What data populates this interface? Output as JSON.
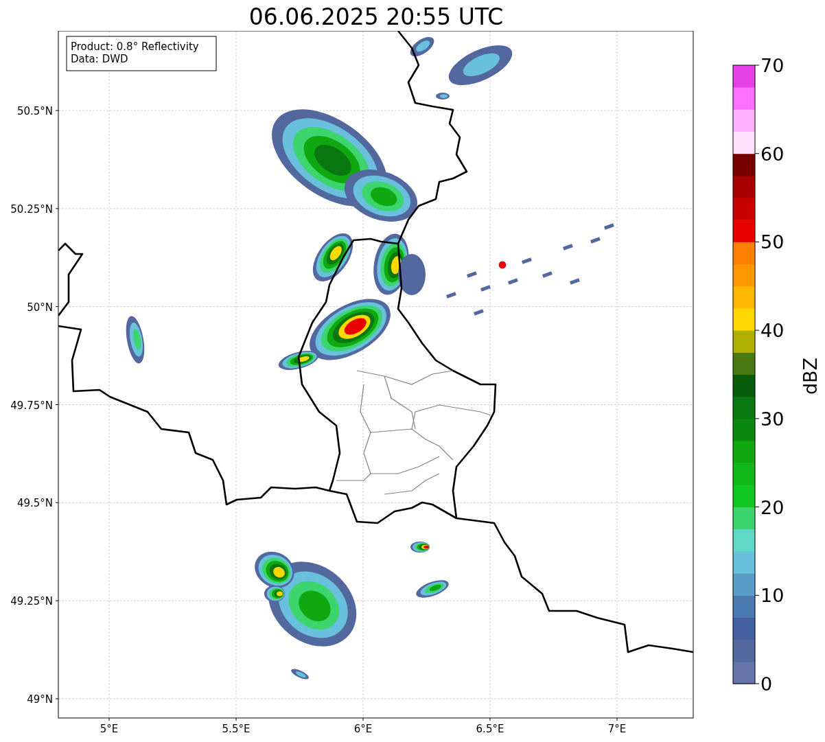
{
  "title": "06.06.2025 20:55 UTC",
  "info_box": {
    "lines": [
      "Product: 0.8° Reflectivity",
      "Data: DWD"
    ]
  },
  "map": {
    "x_ticks": [
      "5°E",
      "5.5°E",
      "6°E",
      "6.5°E",
      "7°E"
    ],
    "y_ticks": [
      "50.5°N",
      "50.25°N",
      "50°N",
      "49.75°N",
      "49.5°N",
      "49.25°N",
      "49°N"
    ]
  },
  "colorbar": {
    "label": "dBZ",
    "ticks": [
      "70",
      "60",
      "50",
      "40",
      "30",
      "20",
      "10",
      "0"
    ],
    "bands": [
      {
        "color": "#6474a8"
      },
      {
        "color": "#5468a0"
      },
      {
        "color": "#4460a0"
      },
      {
        "color": "#4a7ab0"
      },
      {
        "color": "#5a9cc8"
      },
      {
        "color": "#68c0dc"
      },
      {
        "color": "#60d8c8"
      },
      {
        "color": "#3cd46c"
      },
      {
        "color": "#10c820"
      },
      {
        "color": "#10b818"
      },
      {
        "color": "#10a810"
      },
      {
        "color": "#0a8810"
      },
      {
        "color": "#0a7810"
      },
      {
        "color": "#085c0c"
      },
      {
        "color": "#4a7810"
      },
      {
        "color": "#b0b000"
      },
      {
        "color": "#ffd800"
      },
      {
        "color": "#ffb800"
      },
      {
        "color": "#ff9800"
      },
      {
        "color": "#ff8000"
      },
      {
        "color": "#e80000"
      },
      {
        "color": "#c80000"
      },
      {
        "color": "#a80000"
      },
      {
        "color": "#780000"
      },
      {
        "color": "#ffe0ff"
      },
      {
        "color": "#ffb0ff"
      },
      {
        "color": "#ff70ff"
      },
      {
        "color": "#e840e8"
      }
    ]
  }
}
